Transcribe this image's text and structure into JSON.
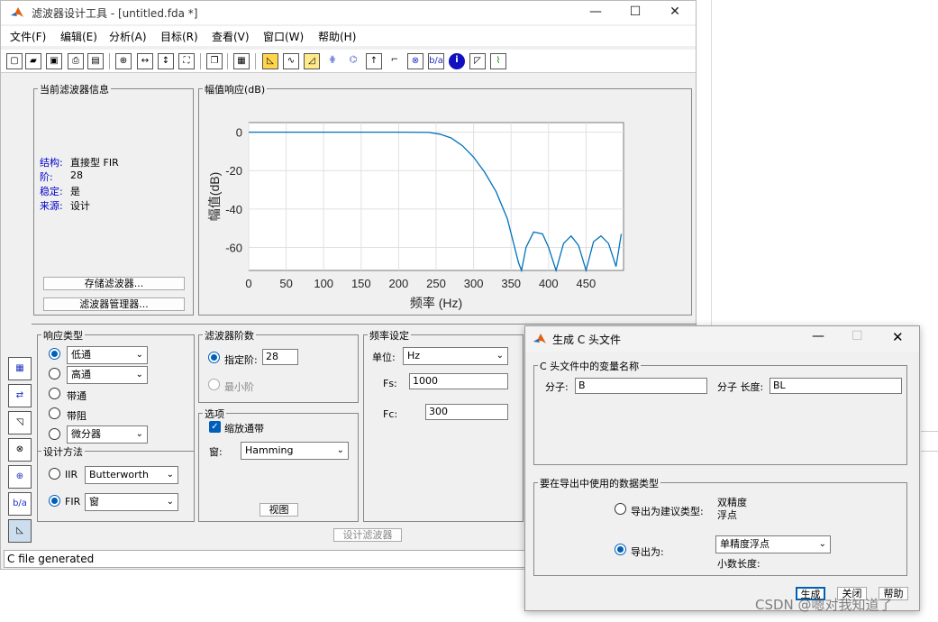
{
  "window": {
    "title": "滤波器设计工具 - [untitled.fda *]",
    "min": "—",
    "max": "☐",
    "close": "✕"
  },
  "menu": [
    "文件(F)",
    "编辑(E)",
    "分析(A)",
    "目标(R)",
    "查看(V)",
    "窗口(W)",
    "帮助(H)"
  ],
  "toolbar_icons": [
    "new-icon",
    "open-icon",
    "save-icon",
    "print-icon",
    "print-preview-icon",
    "zoom-in-icon",
    "zoom-x-icon",
    "zoom-y-icon",
    "full-view-icon",
    "new-window-icon",
    "legend-icon",
    "magnitude-icon",
    "phase-icon",
    "mag-phase-icon",
    "group-delay-icon",
    "phase-delay-icon",
    "impulse-icon",
    "step-icon",
    "pole-zero-icon",
    "coeffs-icon",
    "info-icon",
    "cost-icon",
    "magnitude-estimate-icon"
  ],
  "info_panel": {
    "title": "当前滤波器信息",
    "structure_label": "结构:",
    "structure": "直接型 FIR",
    "order_label": "阶:",
    "order": "28",
    "stable_label": "稳定:",
    "stable": "是",
    "source_label": "来源:",
    "source": "设计",
    "store_btn": "存储滤波器...",
    "manager_btn": "滤波器管理器..."
  },
  "plot_panel": {
    "title": "幅值响应(dB)"
  },
  "chart_data": {
    "type": "line",
    "xlabel": "频率 (Hz)",
    "ylabel": "幅值(dB)",
    "xlim": [
      0,
      500
    ],
    "ylim": [
      -72,
      5
    ],
    "xticks": [
      0,
      50,
      100,
      150,
      200,
      250,
      300,
      350,
      400,
      450
    ],
    "yticks": [
      0,
      -20,
      -40,
      -60
    ],
    "grid": true,
    "x": [
      0,
      50,
      100,
      150,
      200,
      240,
      255,
      270,
      285,
      300,
      315,
      330,
      345,
      360,
      364,
      370,
      380,
      392,
      400,
      410,
      420,
      430,
      440,
      450,
      460,
      470,
      480,
      490,
      497
    ],
    "y": [
      0,
      0,
      0,
      0,
      0,
      -0.1,
      -1,
      -3,
      -7,
      -13,
      -21,
      -31,
      -45,
      -68,
      -72,
      -60,
      -52,
      -53,
      -60,
      -72,
      -58,
      -54,
      -59,
      -72,
      -57,
      -54,
      -58,
      -70,
      -53
    ],
    "color": "#0072bd"
  },
  "response": {
    "title": "响应类型",
    "lowpass": "低通",
    "highpass": "高通",
    "bandpass": "带通",
    "bandstop": "带阻",
    "diff": "微分器",
    "method_title": "设计方法",
    "iir": "IIR",
    "iir_sel": "Butterworth",
    "fir": "FIR",
    "fir_sel": "窗"
  },
  "order": {
    "title": "滤波器阶数",
    "specify": "指定阶:",
    "value": "28",
    "min": "最小阶"
  },
  "options": {
    "title": "选项",
    "scale": "缩放通带",
    "window_label": "窗:",
    "window": "Hamming",
    "view_btn": "视图"
  },
  "freq": {
    "title": "频率设定",
    "unit_label": "单位:",
    "unit": "Hz",
    "fs_label": "Fs:",
    "fs": "1000",
    "fc_label": "Fc:",
    "fc": "300"
  },
  "design_btn": "设计滤波器",
  "status": "C file generated",
  "dialog": {
    "title": "生成 C 头文件",
    "group1": "C 头文件中的变量名称",
    "num_label": "分子:",
    "num": "B",
    "numlen_label": "分子 长度:",
    "numlen": "BL",
    "group2": "要在导出中使用的数据类型",
    "opt1": "导出为建议类型:",
    "opt1_val1": "双精度",
    "opt1_val2": "浮点",
    "opt2": "导出为:",
    "opt2_sel": "单精度浮点",
    "frac": "小数长度:",
    "gen": "生成",
    "close": "关闭",
    "help": "帮助"
  },
  "watermark": "CSDN @嗯对我知道了"
}
